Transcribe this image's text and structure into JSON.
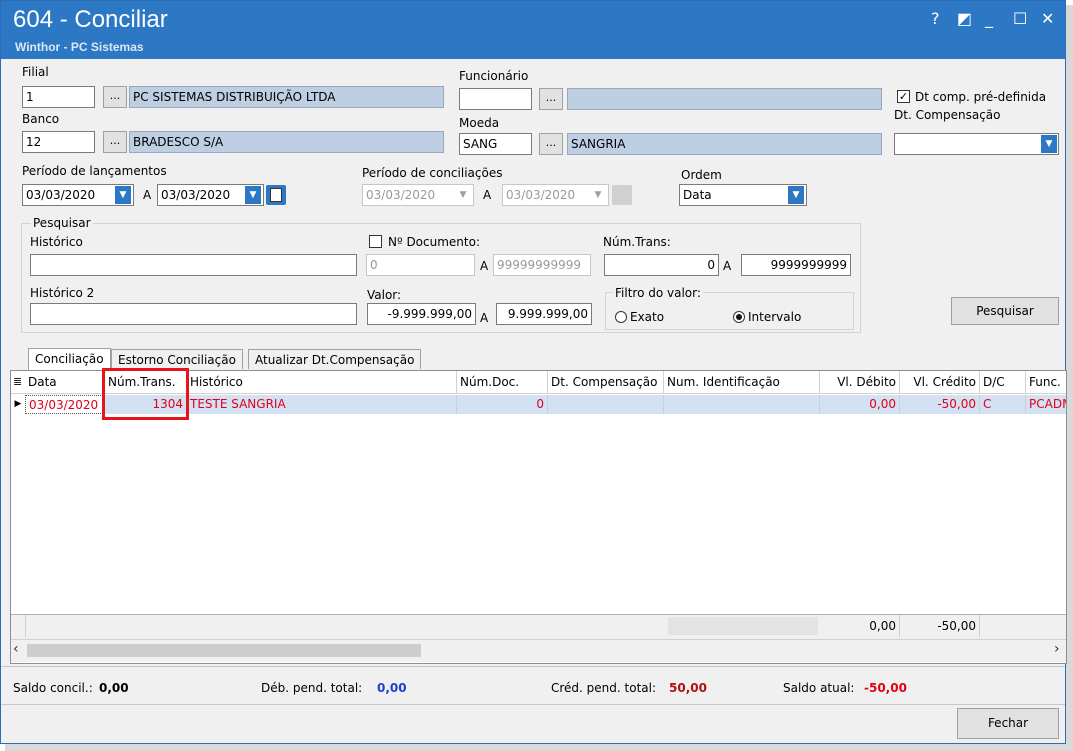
{
  "window": {
    "title": "604 - Conciliar",
    "subtitle": "Winthor - PC Sistemas",
    "controls": [
      "?",
      "◩",
      "_",
      "☐",
      "✕"
    ],
    "accent": "#2c78c4"
  },
  "header": {
    "filial_label": "Filial",
    "filial_value": "1",
    "filial_name": "PC SISTEMAS DISTRIBUIÇÃO LTDA",
    "banco_label": "Banco",
    "banco_value": "12",
    "banco_name": "BRADESCO S/A",
    "funcionario_label": "Funcionário",
    "funcionario_value": "",
    "funcionario_name": "",
    "moeda_label": "Moeda",
    "moeda_value": "SANG",
    "moeda_name": "SANGRIA",
    "lookup_button": "...",
    "dt_comp_checkbox": "Dt comp. pré-definida",
    "dt_compensacao_label": "Dt. Compensação",
    "dt_compensacao_value": ""
  },
  "periodo": {
    "lancamentos_label": "Período de lançamentos",
    "lanc_from": "03/03/2020",
    "lanc_to": "03/03/2020",
    "a_label": "A",
    "conciliacoes_label": "Período de conciliações",
    "conc_from": "03/03/2020",
    "conc_to": "03/03/2020",
    "ordem_label": "Ordem",
    "ordem_value": "Data"
  },
  "pesquisar": {
    "group_label": "Pesquisar",
    "historico_label": "Histórico",
    "historico_value": "",
    "historico2_label": "Histórico 2",
    "historico2_value": "",
    "ndoc_label": "Nº Documento:",
    "ndoc_from": "0",
    "ndoc_to": "99999999999",
    "numtrans_label": "Núm.Trans:",
    "numtrans_from": "0",
    "numtrans_to": "9999999999",
    "valor_label": "Valor:",
    "valor_from": "-9.999.999,00",
    "valor_to": "9.999.999,00",
    "filtro_label": "Filtro do valor:",
    "exato_label": "Exato",
    "intervalo_label": "Intervalo",
    "pesquisar_button": "Pesquisar"
  },
  "tabs": [
    "Conciliação",
    "Estorno Conciliação",
    "Atualizar Dt.Compensação"
  ],
  "grid": {
    "columns": [
      "Data",
      "Núm.Trans.",
      "Histórico",
      "Núm.Doc.",
      "Dt. Compensação",
      "Num. Identificação",
      "Vl. Débito",
      "Vl. Crédito",
      "D/C",
      "Func."
    ],
    "rows": [
      [
        "03/03/2020",
        "1304",
        "TESTE SANGRIA",
        "0",
        "",
        "",
        "0,00",
        "-50,00",
        "C",
        "PCADM"
      ]
    ],
    "footer_debito": "0,00",
    "footer_credito": "-50,00"
  },
  "status": {
    "saldo_concil_label": "Saldo concil.:",
    "saldo_concil_value": "0,00",
    "deb_pend_label": "Déb. pend. total:",
    "deb_pend_value": "0,00",
    "cred_pend_label": "Créd. pend. total:",
    "cred_pend_value": "50,00",
    "saldo_atual_label": "Saldo atual:",
    "saldo_atual_value": "-50,00",
    "fechar_button": "Fechar"
  }
}
